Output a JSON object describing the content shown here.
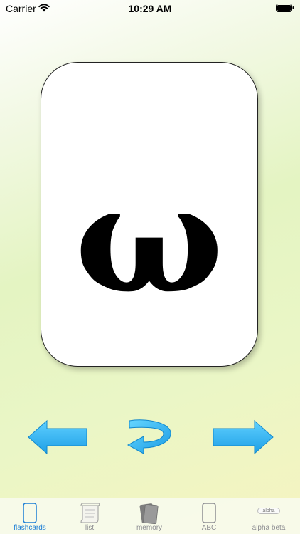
{
  "status_bar": {
    "carrier": "Carrier",
    "time": "10:29 AM",
    "wifi_icon": "wifi-icon",
    "battery_icon": "battery-icon"
  },
  "card": {
    "glyph": "ω"
  },
  "controls": {
    "prev_icon": "arrow-left-icon",
    "flip_icon": "flip-arrow-icon",
    "next_icon": "arrow-right-icon"
  },
  "tabs": [
    {
      "label": "flashcards",
      "icon": "flashcard-icon",
      "active": true
    },
    {
      "label": "list",
      "icon": "scroll-icon",
      "active": false
    },
    {
      "label": "memory",
      "icon": "cards-stack-icon",
      "active": false
    },
    {
      "label": "ABC",
      "icon": "card-outline-icon",
      "active": false
    },
    {
      "label": "alpha beta",
      "icon": "alpha-beta-icon",
      "icon_text": "alpha",
      "active": false
    }
  ],
  "colors": {
    "active_tab": "#1c7ed6",
    "inactive_tab": "#8e8e93",
    "arrow_blue": "#35b6f2"
  }
}
